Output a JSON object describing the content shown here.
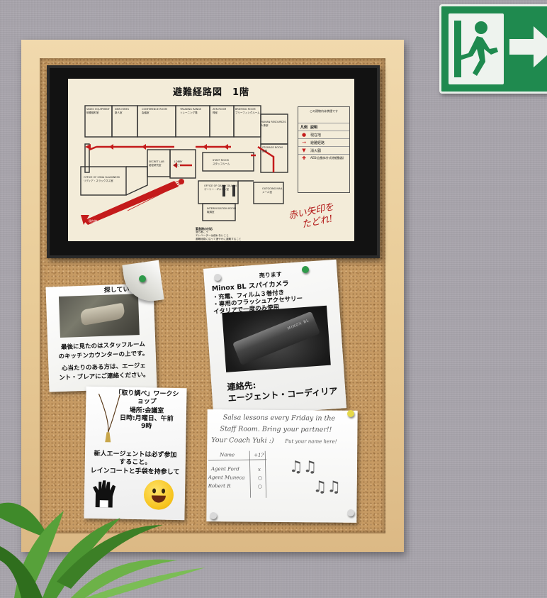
{
  "scene": {
    "map": {
      "title": "避難経路図　1階",
      "rooms": [
        "VIDEO EQUIPMENT",
        "映像機材室",
        "NEW HIRES",
        "新人室",
        "CONFERENCE ROOM",
        "会議室",
        "TRAINING RANGE",
        "トレーニング場",
        "ZEN ROOM",
        "禅室",
        "BRIEFING ROOM",
        "ブリーフィングルーム",
        "HUMAN RESOURCES",
        "人事部",
        "STORAGE ROOM",
        "倉庫",
        "SECRET LAB",
        "秘密研究室",
        "LOBBY",
        "ロビー",
        "STAFF ROOM",
        "スタッフルーム",
        "OFFICE OF GARRY GILSON",
        "ゲーリー・ギルソン室",
        "OFFICE OF LYDIA SLACKNESS",
        "リディア・スラックネス室",
        "OUTGOING MAIL",
        "メール室",
        "INTERROGATION ROOM",
        "取調室"
      ],
      "legend": {
        "header_left": "凡例",
        "header_right": "説明",
        "no_smoking": "この建物内は禁煙です",
        "items": [
          {
            "symbol": "●",
            "label": "現在地"
          },
          {
            "symbol": "→",
            "label": "避難経路"
          },
          {
            "symbol": "▼",
            "label": "消火器"
          },
          {
            "symbol": "✚",
            "label": "AED(自動体外式除細動器)"
          }
        ]
      },
      "start_label": "現在地",
      "emergency_title": "緊急時の対応",
      "emergency_lines": [
        "落ち着こう",
        "エレベーターは使わないこと",
        "避難経路に沿って速やかに避難すること"
      ],
      "handwritten": [
        "赤い矢印を",
        "たどれ!"
      ]
    },
    "notes": {
      "lost": {
        "title": "探しています!",
        "line1": "最後に見たのはスタッフルーム",
        "line2": "のキッチンカウンターの上です。",
        "line3": "心当たりのある方は、エージェ",
        "line4": "ント・ブレアにご連絡ください。"
      },
      "sale": {
        "title": "売ります",
        "line1": "Minox BL スパイカメラ",
        "line2": "・充電、フィルム３巻付き",
        "line3": "・専用のフラッシュアクセサリー",
        "line4": "イタリアで一度のみ使用",
        "camera_text": "MINOX BL",
        "contact_label": "連絡先:",
        "contact_name": "エージェント・コーディリア"
      },
      "workshop": {
        "line1": "「取り調べ」ワークシ",
        "line2": "ョップ",
        "line3": "場所:会議室",
        "line4": "日時:月曜日、午前",
        "line5": "9時",
        "line6": "新人エージェントは必ず参加",
        "line7": "すること。",
        "line8": "レインコートと手袋を持参して"
      },
      "salsa": {
        "line1": "Salsa lessons every Friday in the",
        "line2": "Staff Room. Bring your partner!!",
        "line3": "Your Coach Yuki :)",
        "put_name": "Put your name here!",
        "col_name": "Name",
        "col_plus": "+1?",
        "rows": [
          {
            "name": "Agent Ford",
            "plus": "x"
          },
          {
            "name": "Agent Muneca",
            "plus": "○"
          },
          {
            "name": "Robert R",
            "plus": "○"
          }
        ]
      }
    },
    "colors": {
      "wall": "#a7a3ab",
      "cork": "#c69a63",
      "frame_wood": "#e9cc98",
      "exit_green": "#1f8a4f",
      "evac_red": "#c41b1b"
    }
  }
}
